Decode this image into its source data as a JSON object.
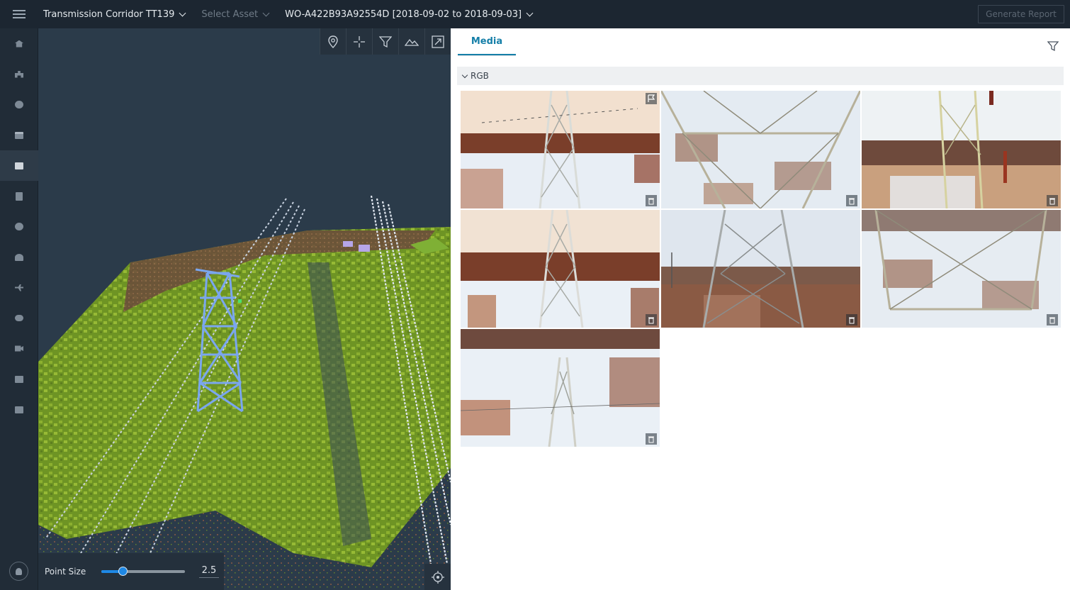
{
  "topbar": {
    "corridor": "Transmission Corridor TT139",
    "asset_placeholder": "Select Asset",
    "work_order": "WO-A422B93A92554D [2018-09-02 to 2018-09-03]",
    "generate_report": "Generate Report"
  },
  "leftnav": {
    "items": [
      "home-icon",
      "hierarchy-icon",
      "cluster-icon",
      "calendar-icon",
      "image-icon",
      "document-icon",
      "cluster-icon",
      "dashboard-icon",
      "flight-icon",
      "cloud-upload-icon",
      "video-icon",
      "image-icon",
      "image-icon"
    ],
    "active_index": 4
  },
  "viewer": {
    "tools": [
      "location-pin-icon",
      "crosshair-icon",
      "filter-icon",
      "terrain-icon",
      "expand-icon"
    ],
    "point_size_label": "Point Size",
    "point_size_value": "2.5",
    "point_size_fraction": 0.25
  },
  "media": {
    "tab": "Media",
    "group": "RGB",
    "images": [
      {
        "flagged": true
      },
      {
        "flagged": false
      },
      {
        "flagged": false
      },
      {
        "flagged": false
      },
      {
        "flagged": false
      },
      {
        "flagged": false
      },
      {
        "flagged": false
      }
    ]
  },
  "colors": {
    "accent": "#157fa8",
    "slider": "#1e88e5",
    "vegetation": "#7fa428",
    "tower": "#6f9be6"
  }
}
